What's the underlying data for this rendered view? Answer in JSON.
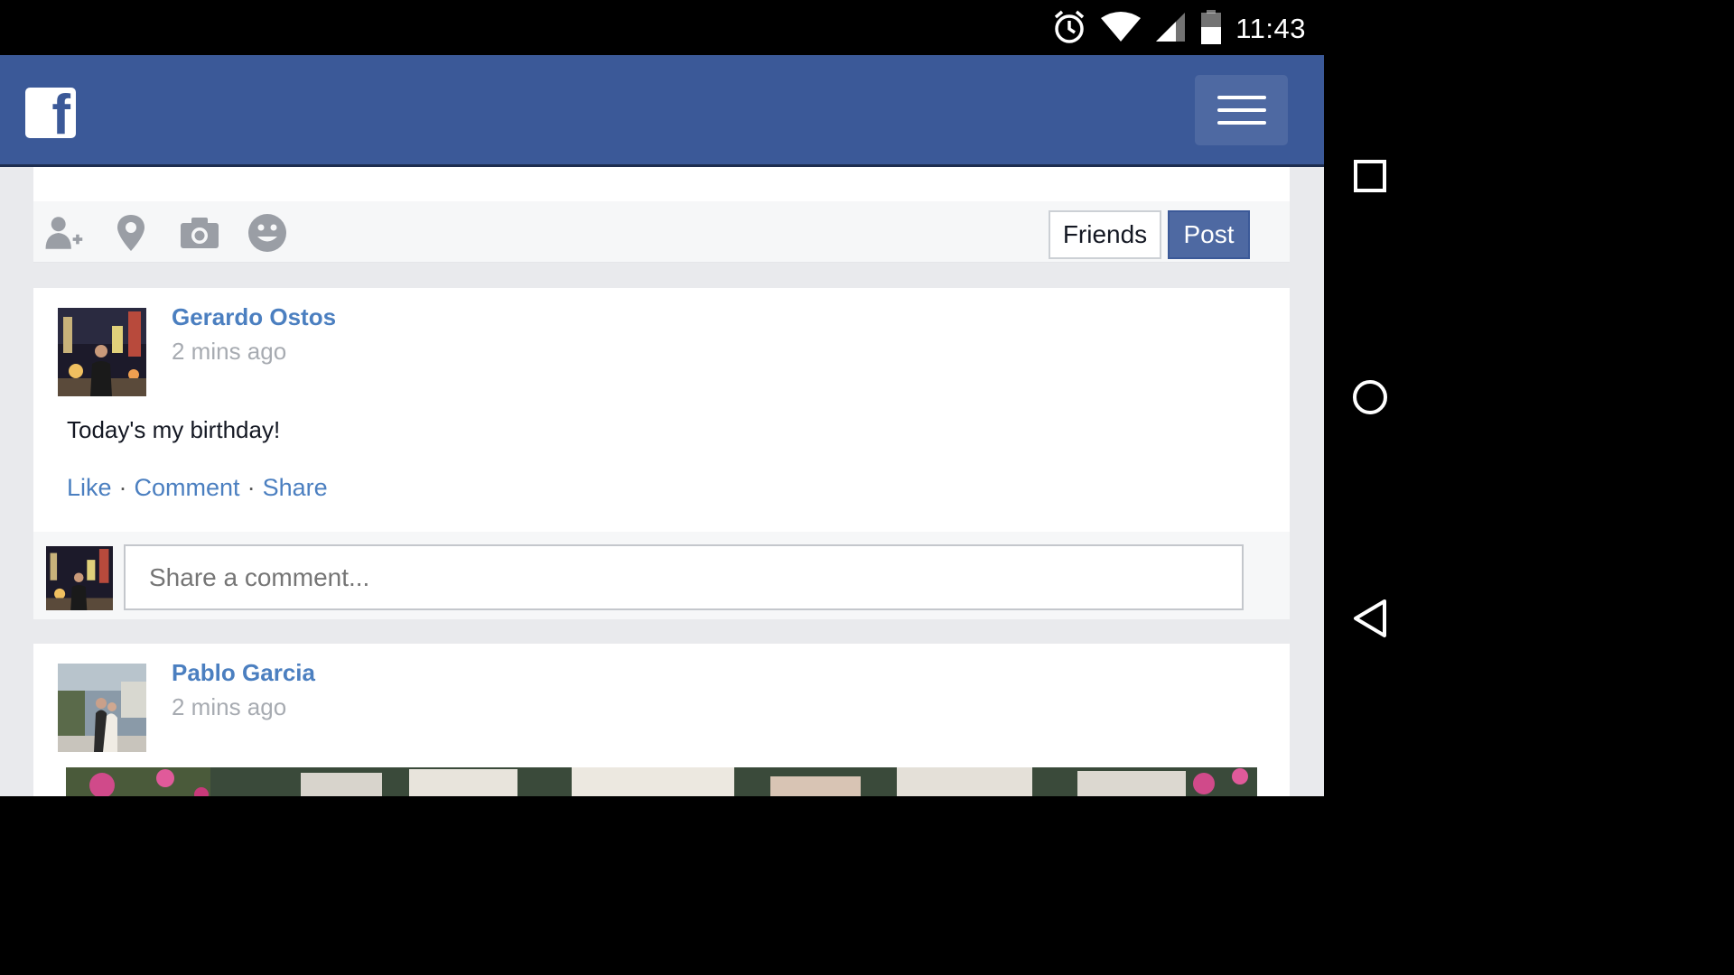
{
  "status_bar": {
    "time": "11:43",
    "icons": [
      "alarm-icon",
      "wifi-icon",
      "cell-signal-icon",
      "battery-icon"
    ]
  },
  "nav_bar": {
    "buttons": [
      "recents-square-icon",
      "home-circle-icon",
      "back-triangle-icon"
    ]
  },
  "colors": {
    "brand": "#3b5998",
    "link": "#4b7fc0",
    "background": "#e9eaed"
  },
  "header": {
    "logo": "facebook-logo",
    "menu_icon": "hamburger-menu-icon"
  },
  "composer": {
    "tools": [
      "tag-friends-icon",
      "location-pin-icon",
      "camera-icon",
      "emoji-icon"
    ],
    "audience_label": "Friends",
    "post_label": "Post"
  },
  "posts": [
    {
      "author": "Gerardo Ostos",
      "time": "2 mins ago",
      "text": "Today's my birthday!",
      "actions": {
        "like": "Like",
        "comment": "Comment",
        "share": "Share"
      },
      "comment_placeholder": "Share a comment..."
    },
    {
      "author": "Pablo Garcia",
      "time": "2 mins ago"
    }
  ]
}
